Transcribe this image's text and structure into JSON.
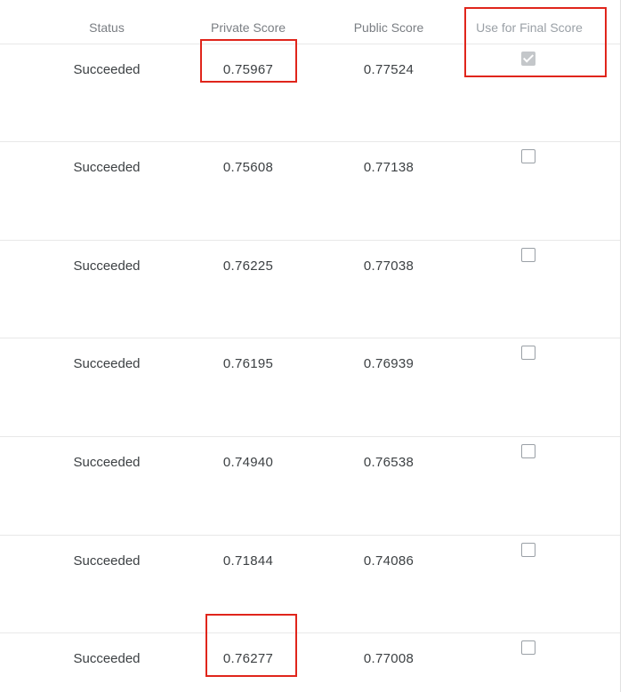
{
  "columns": {
    "status": "Status",
    "private_score": "Private Score",
    "public_score": "Public Score",
    "use_for_final": "Use for Final Score"
  },
  "rows": [
    {
      "status": "Succeeded",
      "private_score": "0.75967",
      "public_score": "0.77524",
      "use_for_final": true
    },
    {
      "status": "Succeeded",
      "private_score": "0.75608",
      "public_score": "0.77138",
      "use_for_final": false
    },
    {
      "status": "Succeeded",
      "private_score": "0.76225",
      "public_score": "0.77038",
      "use_for_final": false
    },
    {
      "status": "Succeeded",
      "private_score": "0.76195",
      "public_score": "0.76939",
      "use_for_final": false
    },
    {
      "status": "Succeeded",
      "private_score": "0.74940",
      "public_score": "0.76538",
      "use_for_final": false
    },
    {
      "status": "Succeeded",
      "private_score": "0.71844",
      "public_score": "0.74086",
      "use_for_final": false
    },
    {
      "status": "Succeeded",
      "private_score": "0.76277",
      "public_score": "0.77008",
      "use_for_final": false
    }
  ],
  "colors": {
    "highlight_box": "#e0251b",
    "header_text": "#7a7e83",
    "cell_text": "#3c4043",
    "divider": "#e8e8e8"
  }
}
